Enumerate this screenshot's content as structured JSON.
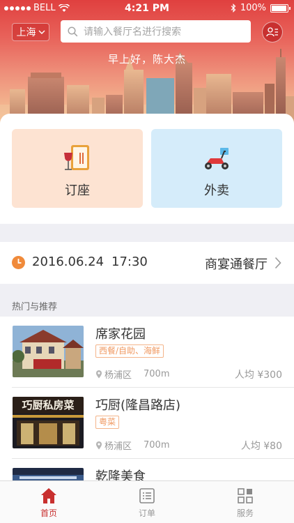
{
  "status_bar": {
    "carrier": "BELL",
    "time": "4:21 PM",
    "battery": "100%"
  },
  "header": {
    "city": "上海",
    "search_placeholder": "请输入餐厅名进行搜索",
    "greeting": "早上好，陈大杰"
  },
  "categories": [
    {
      "label": "订座",
      "icon": "menu-wine-icon"
    },
    {
      "label": "外卖",
      "icon": "scooter-icon"
    }
  ],
  "booking": {
    "date": "2016.06.24",
    "time": "17:30",
    "restaurant": "商宴通餐厅"
  },
  "section_title": "热门与推荐",
  "restaurants": [
    {
      "name": "席家花园",
      "tag": "西餐/自助、海鲜",
      "district": "杨浦区",
      "distance": "700m",
      "price": "人均 ¥300"
    },
    {
      "name": "巧厨(隆昌路店)",
      "tag": "粤菜",
      "district": "杨浦区",
      "distance": "700m",
      "price": "人均 ¥80"
    },
    {
      "name": "乾隆美食",
      "tag": "",
      "district": "",
      "distance": "",
      "price": ""
    }
  ],
  "thumb_text": {
    "qiaochu_sign": "巧厨私房菜"
  },
  "tabbar": [
    {
      "label": "首页",
      "icon": "home-icon",
      "active": true
    },
    {
      "label": "订单",
      "icon": "order-list-icon",
      "active": false
    },
    {
      "label": "服务",
      "icon": "grid-icon",
      "active": false
    }
  ],
  "colors": {
    "accent": "#c8302f",
    "tag_orange": "#f09a63",
    "booking_card": "#fde3d2",
    "takeout_card": "#d5ecfa"
  }
}
